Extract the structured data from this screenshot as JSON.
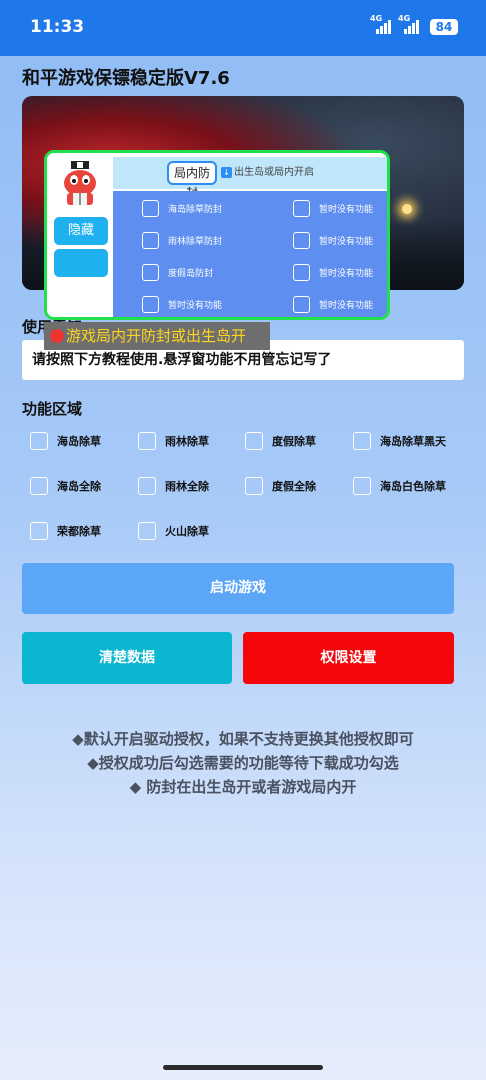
{
  "status_bar": {
    "time": "11:33",
    "net1": "4G",
    "net2": "4G",
    "battery": "84"
  },
  "app": {
    "title": "和平游戏保镖稳定版V7.6"
  },
  "floating_window": {
    "hide_label": "隐藏",
    "tab_active": "局内防封",
    "tab_download": "出生岛或局内开启",
    "left_options": [
      "海岛除草防封",
      "雨林除草防封",
      "度假岛防封",
      "暂时没有功能"
    ],
    "right_options": [
      "暂时没有功能",
      "暂时没有功能",
      "暂时没有功能",
      "暂时没有功能"
    ]
  },
  "tooltip": "游戏局内开防封或出生岛开",
  "notice": {
    "label": "使用需知",
    "text": "请按照下方教程使用.悬浮窗功能不用管忘记写了"
  },
  "features": {
    "label": "功能区域",
    "items": [
      "海岛除草",
      "雨林除草",
      "度假除草",
      "海岛除草黑天",
      "海岛全除",
      "雨林全除",
      "度假全除",
      "海岛白色除草",
      "荣都除草",
      "火山除草"
    ]
  },
  "buttons": {
    "start": "启动游戏",
    "clear": "清楚数据",
    "perm": "权限设置"
  },
  "info": [
    "◆默认开启驱动授权，如果不支持更换其他授权即可",
    "◆授权成功后勾选需要的功能等待下载成功勾选",
    "◆ 防封在出生岛开或者游戏局内开"
  ],
  "colors": {
    "accent": "#1f78ea",
    "start": "#5ba6f6",
    "clear": "#0ab6d0",
    "perm": "#f5060a",
    "float_border": "#21e04b",
    "tooltip_text": "#ffd51e"
  }
}
